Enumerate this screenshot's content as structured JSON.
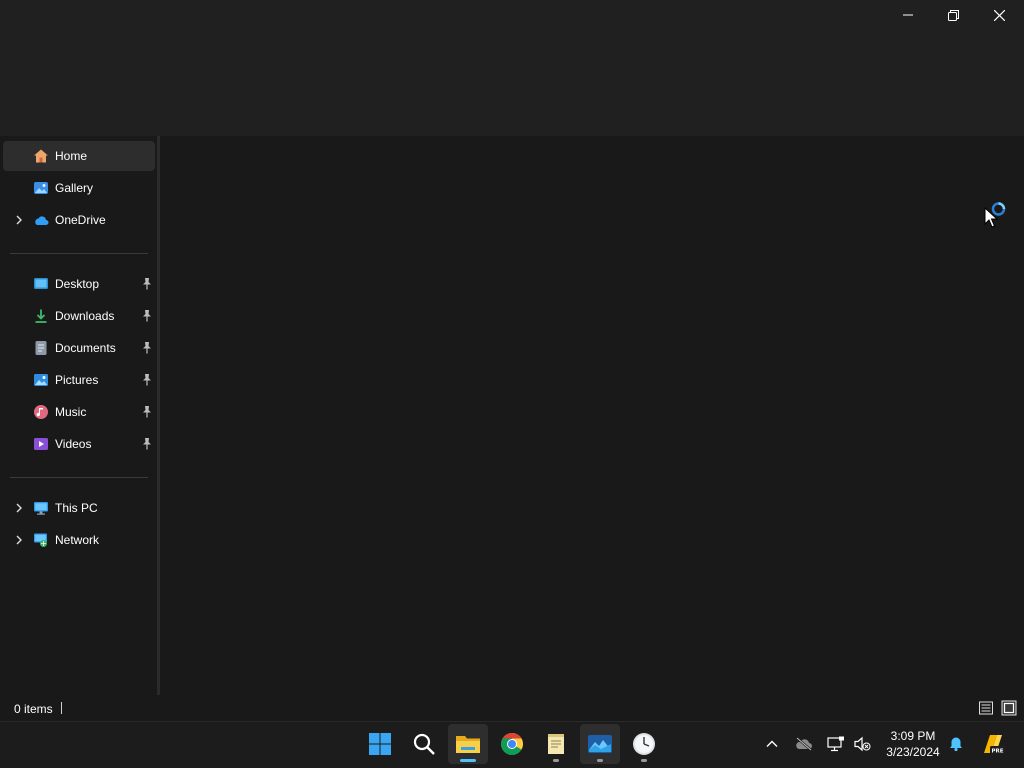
{
  "window": {
    "controls": {
      "minimize": "minimize-icon",
      "restore": "restore-icon",
      "close": "close-icon"
    }
  },
  "sidebar": {
    "quick": [
      {
        "label": "Home",
        "icon": "home-icon",
        "selected": true,
        "expandable": false
      },
      {
        "label": "Gallery",
        "icon": "gallery-icon",
        "selected": false,
        "expandable": false
      },
      {
        "label": "OneDrive",
        "icon": "onedrive-icon",
        "selected": false,
        "expandable": true
      }
    ],
    "pinned": [
      {
        "label": "Desktop",
        "icon": "desktop-icon",
        "pinned": true
      },
      {
        "label": "Downloads",
        "icon": "downloads-icon",
        "pinned": true
      },
      {
        "label": "Documents",
        "icon": "documents-icon",
        "pinned": true
      },
      {
        "label": "Pictures",
        "icon": "pictures-icon",
        "pinned": true
      },
      {
        "label": "Music",
        "icon": "music-icon",
        "pinned": true
      },
      {
        "label": "Videos",
        "icon": "videos-icon",
        "pinned": true
      }
    ],
    "devices": [
      {
        "label": "This PC",
        "icon": "this-pc-icon",
        "expandable": true
      },
      {
        "label": "Network",
        "icon": "network-icon",
        "expandable": true
      }
    ]
  },
  "status": {
    "items_count": "0 items"
  },
  "taskbar": {
    "apps": [
      "start-icon",
      "search-icon",
      "file-explorer-icon",
      "chrome-icon",
      "notepad-icon",
      "photos-app-icon",
      "clock-app-icon"
    ],
    "tray": [
      "show-hidden-icons-chevron",
      "onedrive-offline-icon",
      "network-icon",
      "volume-muted-icon",
      "notification-bell-icon",
      "copilot-pre-icon"
    ],
    "time": "3:09 PM",
    "date": "3/23/2024"
  },
  "colors": {
    "titlebar": "#202020",
    "pane": "#191919",
    "selected_item": "#2d2d2d",
    "accent": "#4cc2ff"
  }
}
